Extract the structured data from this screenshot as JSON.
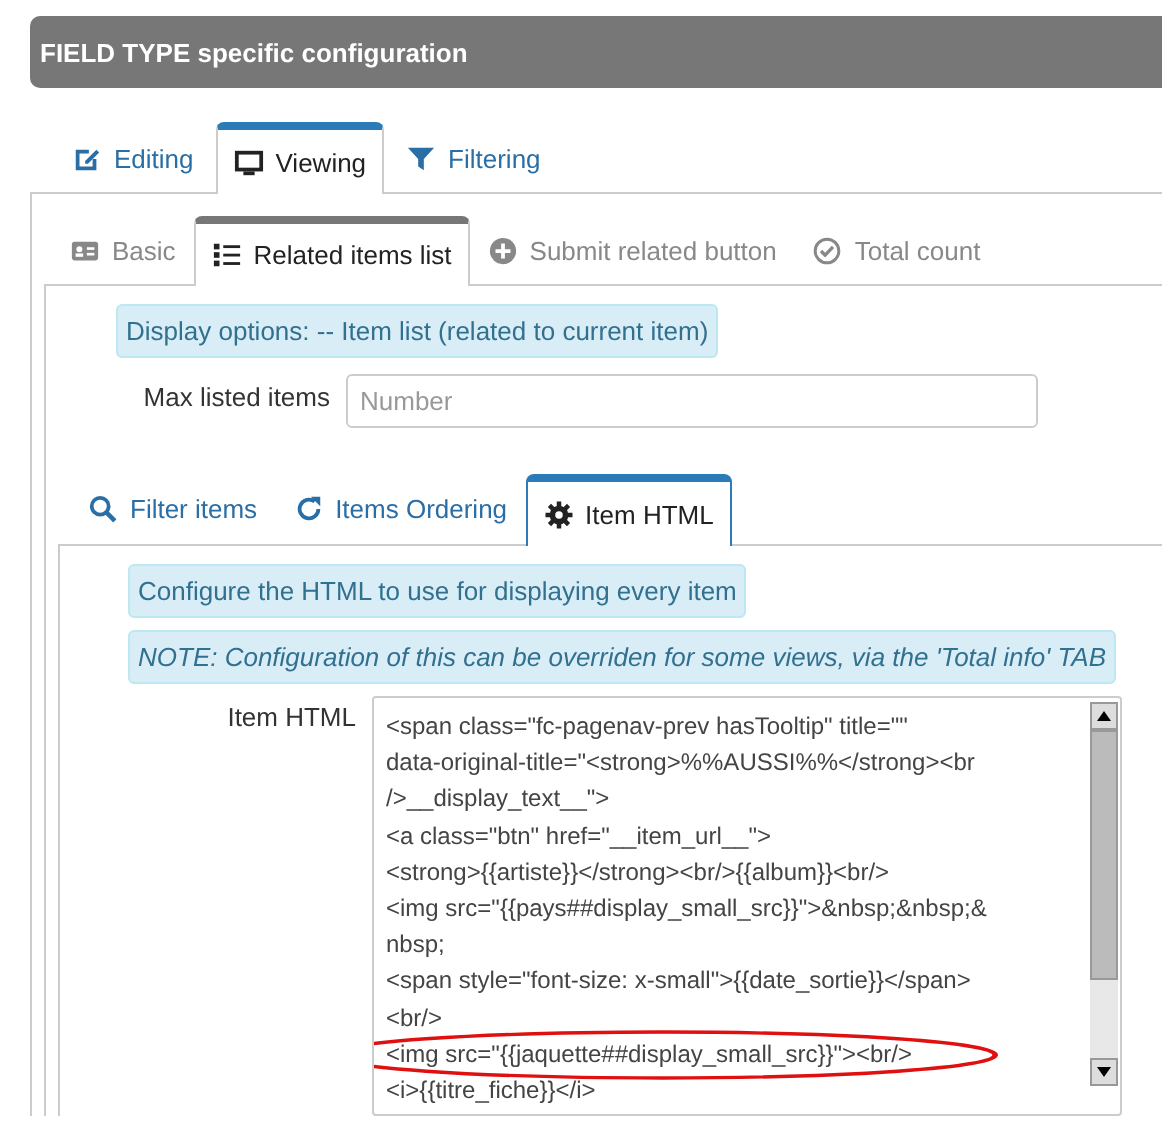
{
  "header": {
    "title": "FIELD TYPE specific configuration"
  },
  "main_tabs": [
    {
      "label": "Editing",
      "selected": false
    },
    {
      "label": "Viewing",
      "selected": true
    },
    {
      "label": "Filtering",
      "selected": false
    }
  ],
  "view_tabs": [
    {
      "label": "Basic",
      "selected": false
    },
    {
      "label": "Related items list",
      "selected": true
    },
    {
      "label": "Submit related button",
      "selected": false
    },
    {
      "label": "Total count",
      "selected": false
    }
  ],
  "display_options": "Display options: -- Item list (related to current item)",
  "max_items": {
    "label": "Max listed items",
    "placeholder": "Number"
  },
  "list_tabs": [
    {
      "label": "Filter items",
      "selected": false
    },
    {
      "label": "Items Ordering",
      "selected": false
    },
    {
      "label": "Item HTML",
      "selected": true
    }
  ],
  "info": "Configure the HTML to use for displaying every item",
  "note": "NOTE: Configuration of this can be overriden for some views, via the 'Total info' TAB",
  "item_html": {
    "label": "Item HTML",
    "lines": [
      {
        "text": "<span class=\"fc-pagenav-prev hasTooltip\" title=\"\"",
        "highlighted": false
      },
      {
        "text": "data-original-title=\"<strong>%%AUSSI%%</strong><br",
        "highlighted": false
      },
      {
        "text": "/>__display_text__\">",
        "highlighted": false
      },
      {
        "text": "<a class=\"btn\" href=\"__item_url__\">",
        "highlighted": false
      },
      {
        "text": "<strong>{{artiste}}</strong><br/>{{album}}<br/>",
        "highlighted": false
      },
      {
        "text": "<img src=\"{{pays##display_small_src}}\">&nbsp;&nbsp;&",
        "highlighted": false
      },
      {
        "text": "nbsp;",
        "highlighted": false
      },
      {
        "text": "<span style=\"font-size: x-small\">{{date_sortie}}</span>",
        "highlighted": false
      },
      {
        "text": "<br/>",
        "highlighted": false
      },
      {
        "text": "<img src=\"{{jaquette##display_small_src}}\"><br/>",
        "highlighted": true
      },
      {
        "text": "<i>{{titre_fiche}}</i>",
        "highlighted": false
      }
    ]
  }
}
